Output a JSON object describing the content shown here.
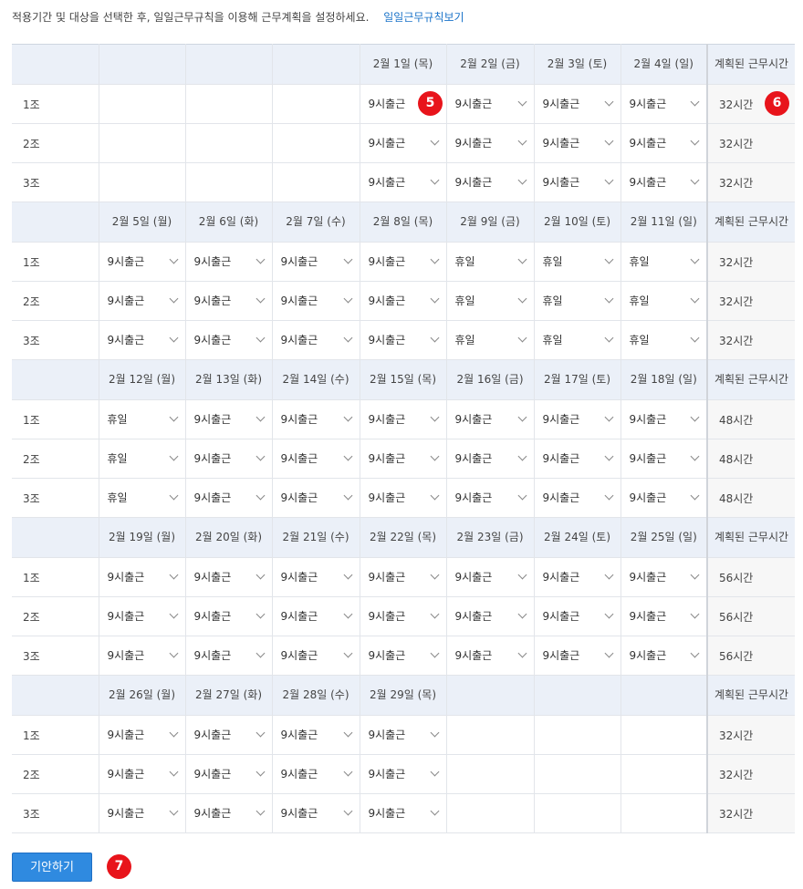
{
  "intro": {
    "text": "적용기간 및 대상을 선택한 후, 일일근무규칙을 이용해 근무계획을 설정하세요.",
    "link": "일일근무규칙보기"
  },
  "total_header": "계획된 근무시간",
  "weeks": [
    {
      "days": [
        "",
        "",
        "",
        "2월 1일 (목)",
        "2월 2일 (금)",
        "2월 3일 (토)",
        "2월 4일 (일)"
      ],
      "rows": [
        {
          "team": "1조",
          "cells": [
            "",
            "",
            "",
            "9시출근",
            "9시출근",
            "9시출근",
            "9시출근"
          ],
          "total": "32시간"
        },
        {
          "team": "2조",
          "cells": [
            "",
            "",
            "",
            "9시출근",
            "9시출근",
            "9시출근",
            "9시출근"
          ],
          "total": "32시간"
        },
        {
          "team": "3조",
          "cells": [
            "",
            "",
            "",
            "9시출근",
            "9시출근",
            "9시출근",
            "9시출근"
          ],
          "total": "32시간"
        }
      ]
    },
    {
      "days": [
        "2월 5일 (월)",
        "2월 6일 (화)",
        "2월 7일 (수)",
        "2월 8일 (목)",
        "2월 9일 (금)",
        "2월 10일 (토)",
        "2월 11일 (일)"
      ],
      "rows": [
        {
          "team": "1조",
          "cells": [
            "9시출근",
            "9시출근",
            "9시출근",
            "9시출근",
            "휴일",
            "휴일",
            "휴일"
          ],
          "total": "32시간"
        },
        {
          "team": "2조",
          "cells": [
            "9시출근",
            "9시출근",
            "9시출근",
            "9시출근",
            "휴일",
            "휴일",
            "휴일"
          ],
          "total": "32시간"
        },
        {
          "team": "3조",
          "cells": [
            "9시출근",
            "9시출근",
            "9시출근",
            "9시출근",
            "휴일",
            "휴일",
            "휴일"
          ],
          "total": "32시간"
        }
      ]
    },
    {
      "days": [
        "2월 12일 (월)",
        "2월 13일 (화)",
        "2월 14일 (수)",
        "2월 15일 (목)",
        "2월 16일 (금)",
        "2월 17일 (토)",
        "2월 18일 (일)"
      ],
      "rows": [
        {
          "team": "1조",
          "cells": [
            "휴일",
            "9시출근",
            "9시출근",
            "9시출근",
            "9시출근",
            "9시출근",
            "9시출근"
          ],
          "total": "48시간"
        },
        {
          "team": "2조",
          "cells": [
            "휴일",
            "9시출근",
            "9시출근",
            "9시출근",
            "9시출근",
            "9시출근",
            "9시출근"
          ],
          "total": "48시간"
        },
        {
          "team": "3조",
          "cells": [
            "휴일",
            "9시출근",
            "9시출근",
            "9시출근",
            "9시출근",
            "9시출근",
            "9시출근"
          ],
          "total": "48시간"
        }
      ]
    },
    {
      "days": [
        "2월 19일 (월)",
        "2월 20일 (화)",
        "2월 21일 (수)",
        "2월 22일 (목)",
        "2월 23일 (금)",
        "2월 24일 (토)",
        "2월 25일 (일)"
      ],
      "rows": [
        {
          "team": "1조",
          "cells": [
            "9시출근",
            "9시출근",
            "9시출근",
            "9시출근",
            "9시출근",
            "9시출근",
            "9시출근"
          ],
          "total": "56시간"
        },
        {
          "team": "2조",
          "cells": [
            "9시출근",
            "9시출근",
            "9시출근",
            "9시출근",
            "9시출근",
            "9시출근",
            "9시출근"
          ],
          "total": "56시간"
        },
        {
          "team": "3조",
          "cells": [
            "9시출근",
            "9시출근",
            "9시출근",
            "9시출근",
            "9시출근",
            "9시출근",
            "9시출근"
          ],
          "total": "56시간"
        }
      ]
    },
    {
      "days": [
        "2월 26일 (월)",
        "2월 27일 (화)",
        "2월 28일 (수)",
        "2월 29일 (목)",
        "",
        "",
        ""
      ],
      "rows": [
        {
          "team": "1조",
          "cells": [
            "9시출근",
            "9시출근",
            "9시출근",
            "9시출근",
            "",
            "",
            ""
          ],
          "total": "32시간"
        },
        {
          "team": "2조",
          "cells": [
            "9시출근",
            "9시출근",
            "9시출근",
            "9시출근",
            "",
            "",
            ""
          ],
          "total": "32시간"
        },
        {
          "team": "3조",
          "cells": [
            "9시출근",
            "9시출근",
            "9시출근",
            "9시출근",
            "",
            "",
            ""
          ],
          "total": "32시간"
        }
      ]
    }
  ],
  "badges": {
    "b5": "5",
    "b6": "6",
    "b7": "7"
  },
  "submit_label": "기안하기",
  "colors": {
    "badge": "#e8141b",
    "link": "#1a73c9",
    "header_bg": "#ebf0f8",
    "button": "#2f8ae0"
  }
}
